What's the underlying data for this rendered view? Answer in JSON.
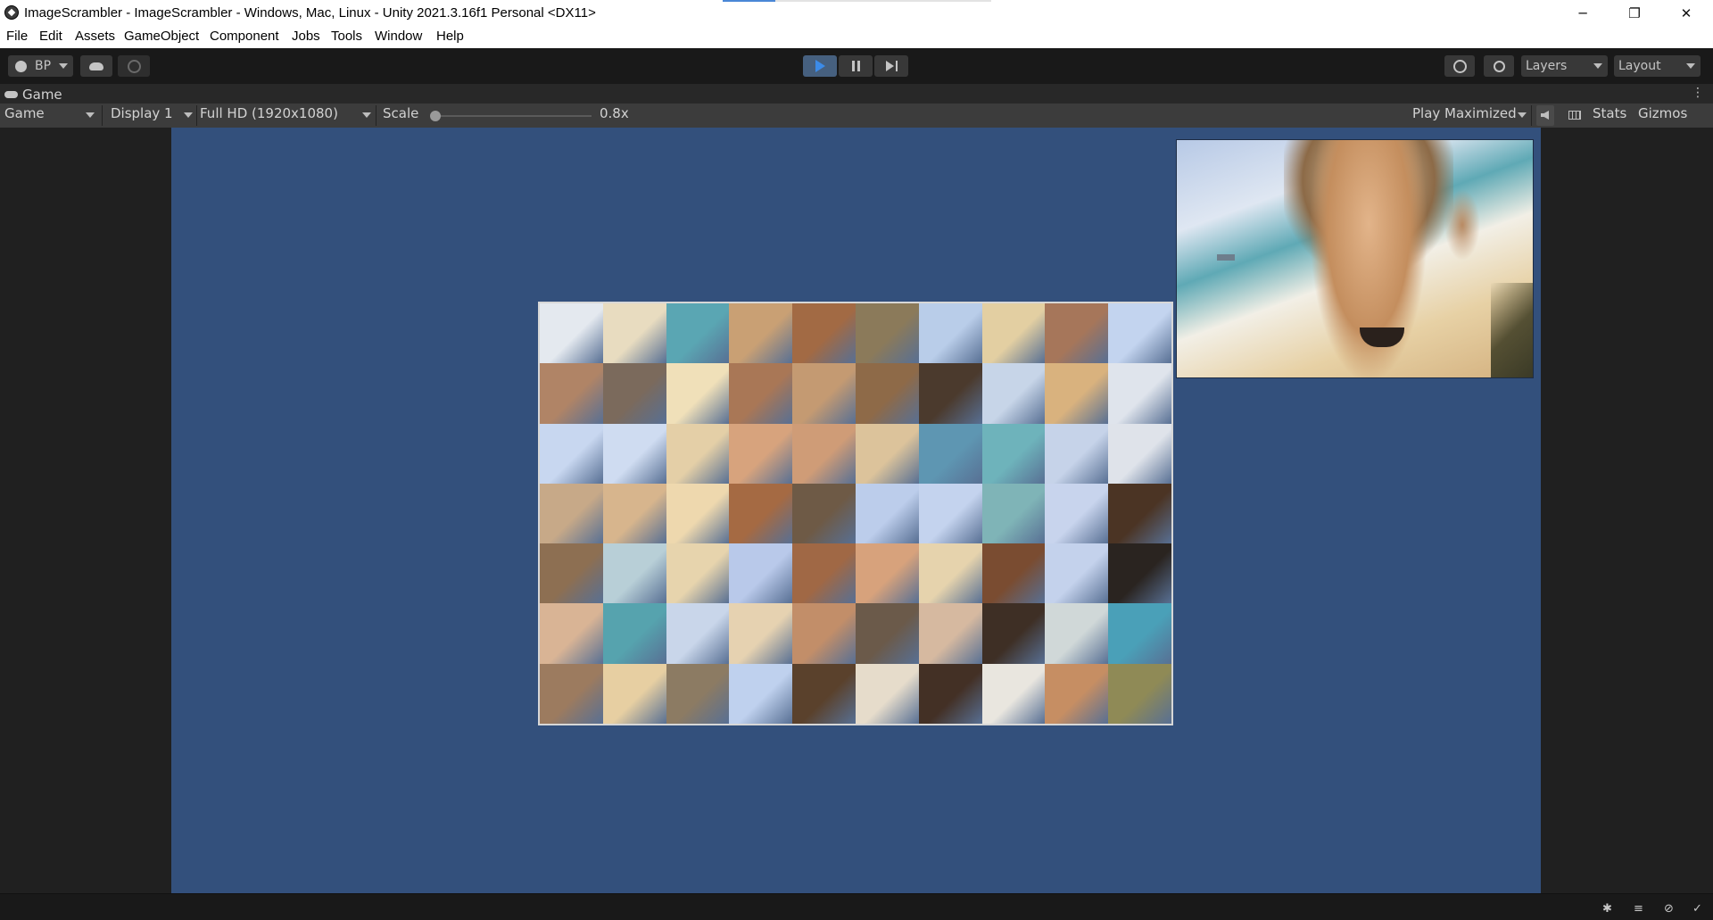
{
  "window": {
    "title": "ImageScrambler - ImageScrambler - Windows, Mac, Linux - Unity 2021.3.16f1 Personal <DX11>",
    "controls": {
      "minimize": "─",
      "maximize": "❐",
      "close": "✕"
    }
  },
  "menu": [
    "File",
    "Edit",
    "Assets",
    "GameObject",
    "Component",
    "Jobs",
    "Tools",
    "Window",
    "Help"
  ],
  "toolbar": {
    "account": "BP",
    "layers": "Layers",
    "layout": "Layout"
  },
  "panel": {
    "tab": "Game"
  },
  "gamebar": {
    "view": "Game",
    "display": "Display 1",
    "resolution": "Full HD (1920x1080)",
    "scale_label": "Scale",
    "scale_value": "0.8x",
    "scale_fraction": 0.0,
    "play_mode": "Play Maximized",
    "stats": "Stats",
    "gizmos": "Gizmos"
  },
  "puzzle": {
    "columns": 10,
    "rows": 7,
    "tile_colors": [
      "#e4e9ef",
      "#e8dcc0",
      "#5aa6b3",
      "#c9a074",
      "#a26a44",
      "#8b7a5a",
      "#b9cde9",
      "#e3cfa2",
      "#a6765a",
      "#c3d4ef",
      "#b08466",
      "#7b6a5c",
      "#f0e0b9",
      "#a97756",
      "#c49a72",
      "#8e6a48",
      "#4b3a2d",
      "#c7d5e8",
      "#d9b27e",
      "#dfe4ec",
      "#c8d7f0",
      "#cfdcf1",
      "#e4cfa7",
      "#d7a37d",
      "#cf9c77",
      "#dcc39b",
      "#5e96b2",
      "#6eb3bb",
      "#c6d3e9",
      "#dfe3ea",
      "#c7a988",
      "#d7b58d",
      "#eed8ae",
      "#a56a43",
      "#6e5a46",
      "#bccdeb",
      "#c4d3ee",
      "#7fb4b7",
      "#c8d4ed",
      "#4b3424",
      "#8d6f52",
      "#b8cfd7",
      "#e7d4ad",
      "#b9c9ea",
      "#a06845",
      "#d7a27c",
      "#e6d3ad",
      "#7a4c31",
      "#c4d2ec",
      "#2a2420",
      "#d9b495",
      "#56a3ae",
      "#c9d6ea",
      "#e6d2b1",
      "#c28e69",
      "#6b5a4a",
      "#d6b9a0",
      "#3e2f25",
      "#d0d8d8",
      "#4aa0b8",
      "#9c7b5f",
      "#e7cfa2",
      "#8c7b63",
      "#bfd1ee",
      "#5a412c",
      "#e6dccb",
      "#433025",
      "#e9e6df",
      "#c68e63",
      "#8f8a56"
    ]
  },
  "preview": {
    "alt": ""
  },
  "statusbar": {
    "icons": [
      "bug-icon",
      "layers-icon",
      "debug-icon",
      "check-icon"
    ]
  }
}
